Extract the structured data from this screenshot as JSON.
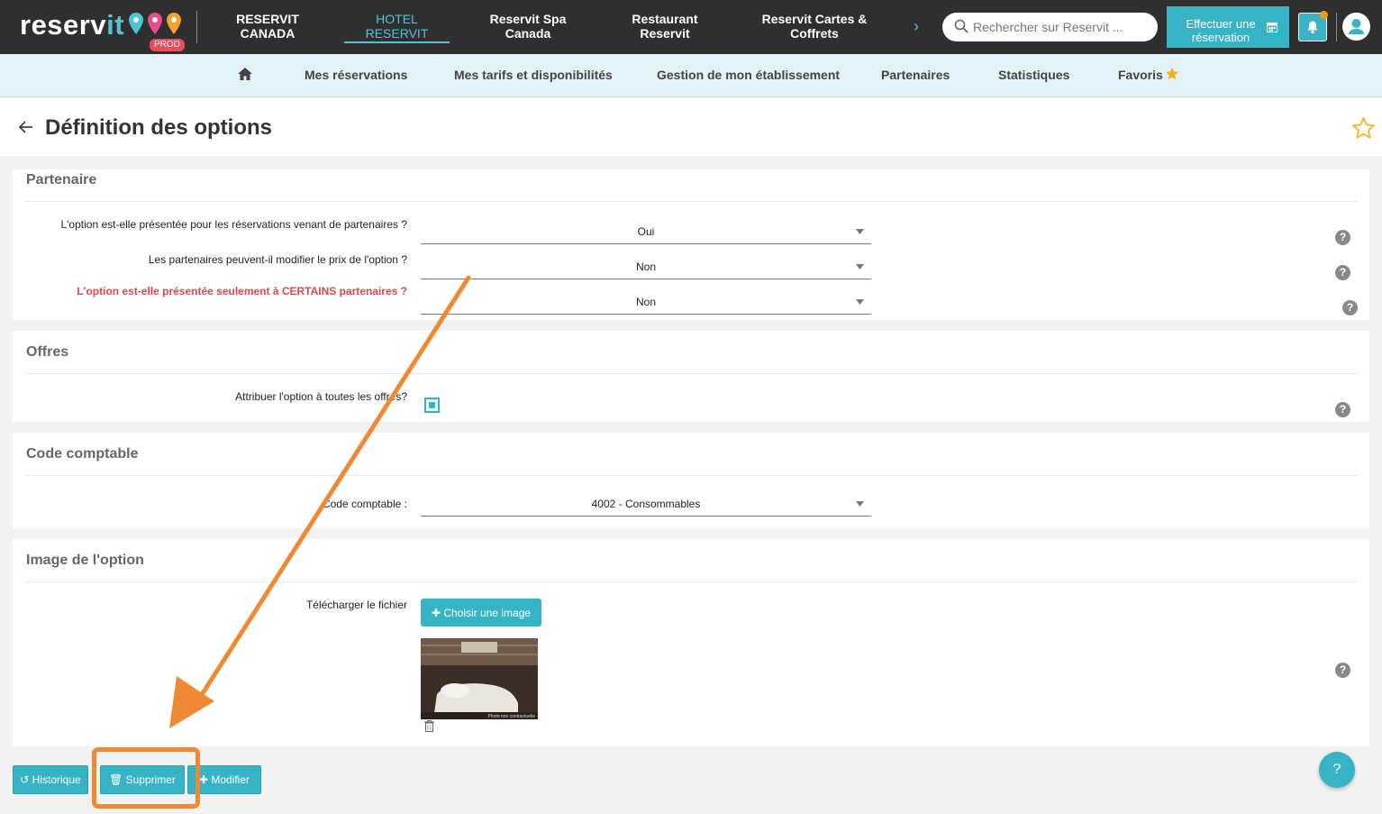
{
  "topbar": {
    "logo_main": "reserv",
    "logo_accent": "it",
    "env_badge": "PROD",
    "nav": [
      {
        "line1": "RESERVIT",
        "line2": "CANADA"
      },
      {
        "line1": "HOTEL",
        "line2": "RESERVIT"
      },
      {
        "line1": "Reservit Spa",
        "line2": "Canada"
      },
      {
        "line1": "Restaurant",
        "line2": "Reservit"
      },
      {
        "line1": "Reservit Cartes &",
        "line2": "Coffrets"
      }
    ],
    "next_glyph": "›",
    "search_placeholder": "Rechercher sur Reservit ...",
    "reserve_line1": "Effectuer une",
    "reserve_line2": "réservation"
  },
  "subnav": {
    "items": [
      "Mes réservations",
      "Mes tarifs et disponibilités",
      "Gestion de mon établissement",
      "Partenaires",
      "Statistiques",
      "Favoris"
    ]
  },
  "page": {
    "title": "Définition des options"
  },
  "sections": {
    "partenaire": {
      "title": "Partenaire",
      "q1": "L'option est-elle présentée pour les réservations venant de partenaires ?",
      "q1_value": "Oui",
      "q2": "Les partenaires peuvent-il modifier le prix de l'option ?",
      "q2_value": "Non",
      "q3": "L'option est-elle présentée seulement à CERTAINS partenaires ?",
      "q3_value": "Non"
    },
    "offres": {
      "title": "Offres",
      "q1": "Attribuer l'option à toutes les offres?"
    },
    "code": {
      "title": "Code comptable",
      "label": "Code comptable :",
      "value": "4002 - Consommables"
    },
    "image": {
      "title": "Image de l'option",
      "label": "Télécharger le fichier",
      "button": "✚ Choisir une image",
      "thumb_caption": "Photo non contractuelle"
    }
  },
  "help_glyph": "?",
  "bottom": {
    "historique": "↺ Historique",
    "supprimer": "🗑 Supprimer",
    "modifier": "✚ Modifier"
  },
  "colors": {
    "accent": "#36b4c6",
    "annotation": "#ee8a36",
    "warning_text": "#e0474c"
  }
}
